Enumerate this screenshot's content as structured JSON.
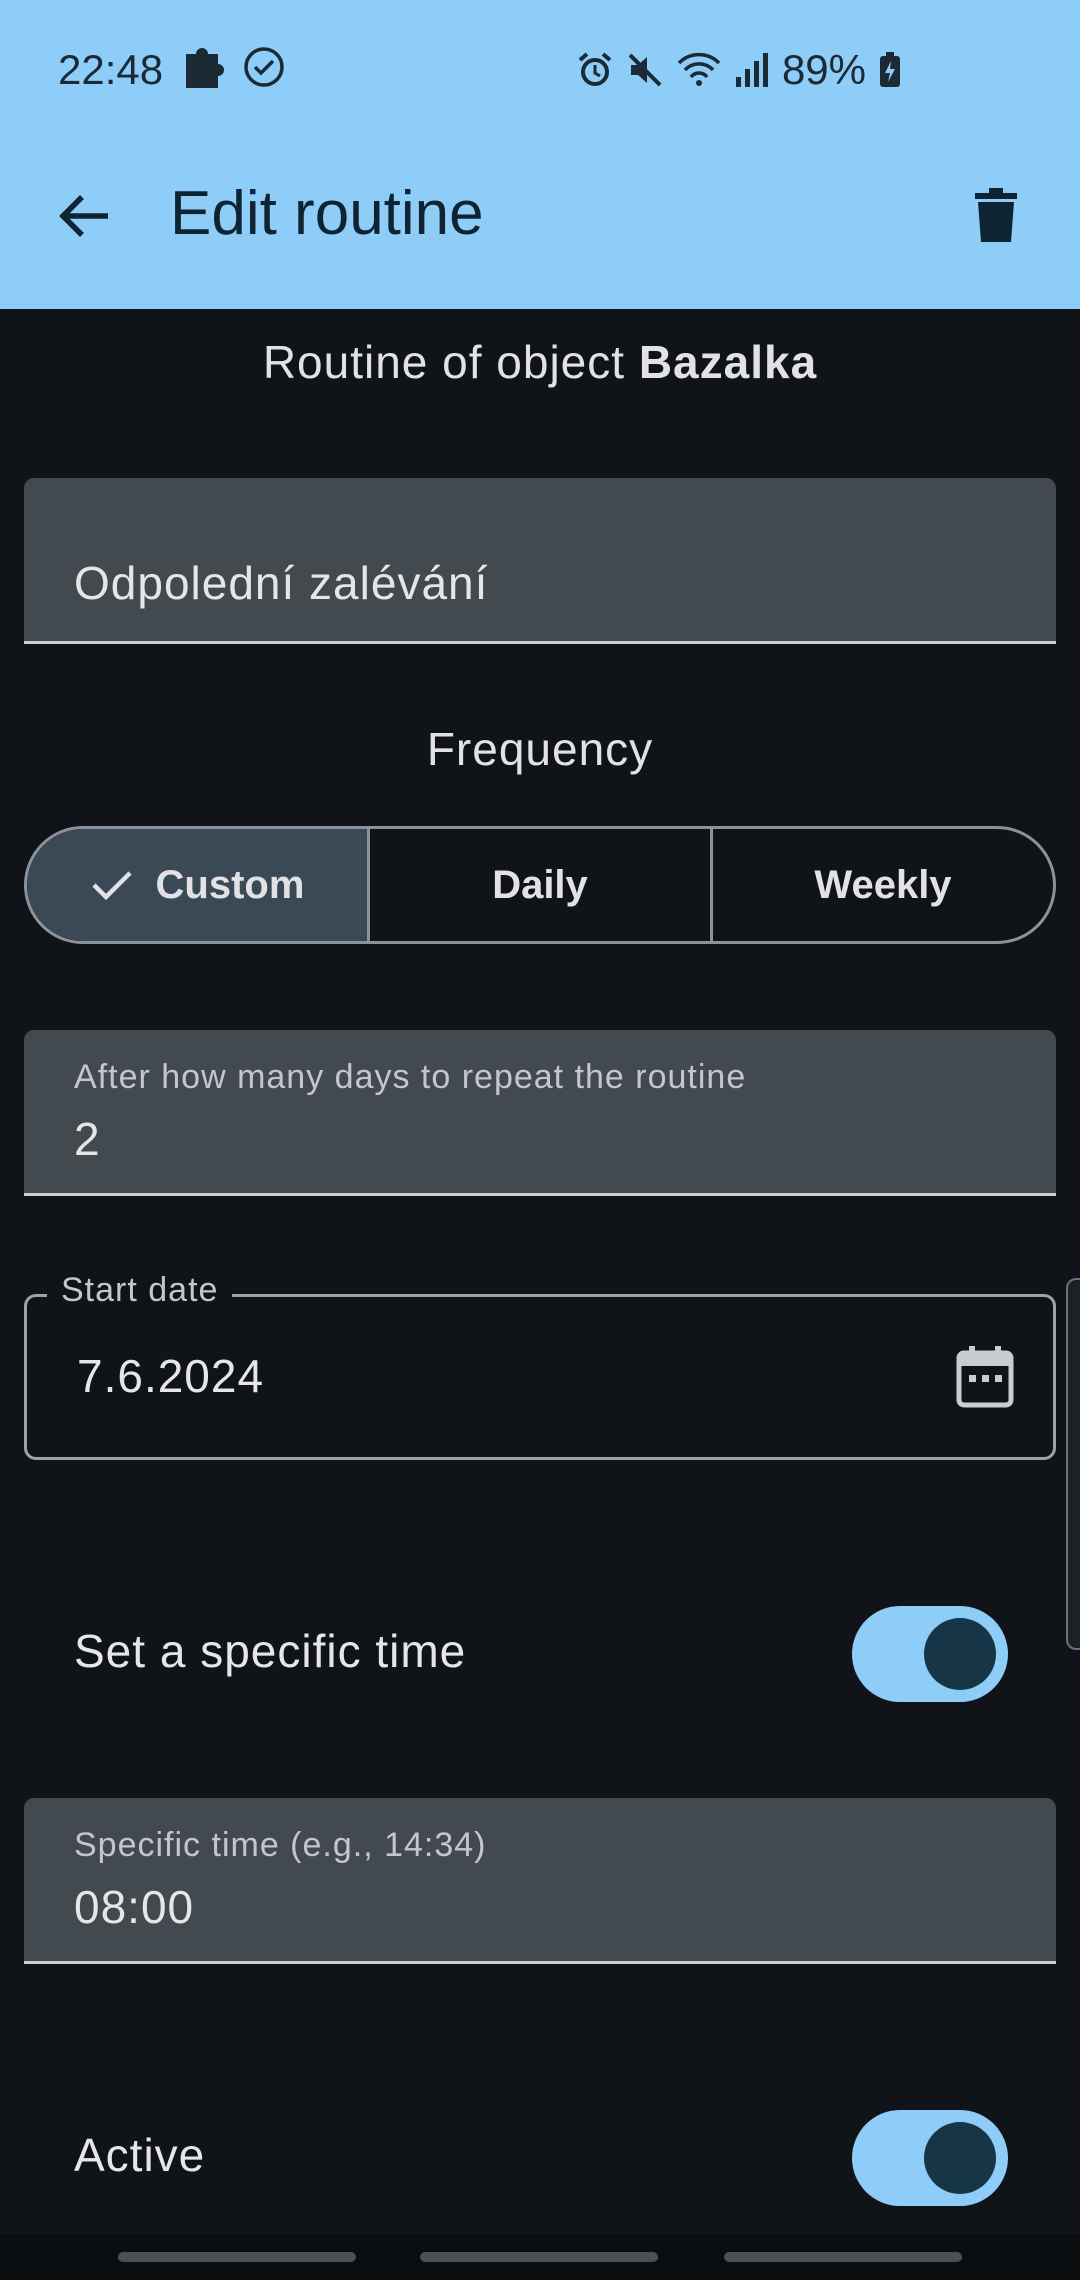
{
  "status_bar": {
    "time": "22:48",
    "battery": "89%",
    "icons_left": [
      "puzzle-icon",
      "check-circle-icon"
    ],
    "icons_right": [
      "alarm-icon",
      "mute-icon",
      "wifi-icon",
      "signal-icon",
      "battery-charging-icon"
    ]
  },
  "toolbar": {
    "title": "Edit routine",
    "background_color": "#8ecdf8"
  },
  "subtitle": {
    "prefix": "Routine of object",
    "object_name": "Bazalka"
  },
  "routine_name": {
    "value": "Odpolední zalévání"
  },
  "frequency": {
    "label": "Frequency",
    "options": [
      "Custom",
      "Daily",
      "Weekly"
    ],
    "selected": "Custom"
  },
  "repeat_days": {
    "label": "After how many days to repeat the routine",
    "value": "2"
  },
  "start_date": {
    "label": "Start date",
    "value": "7.6.2024"
  },
  "specific_time_toggle": {
    "label": "Set a specific time",
    "on": true
  },
  "specific_time": {
    "label": "Specific time (e.g., 14:34)",
    "value": "08:00"
  },
  "active_toggle": {
    "label": "Active",
    "on": true
  }
}
